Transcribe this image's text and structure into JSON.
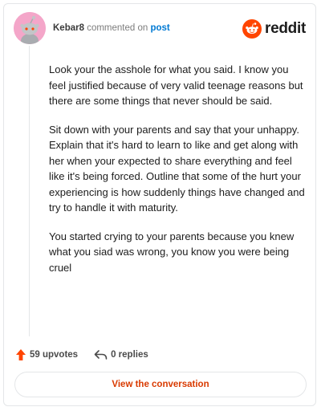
{
  "comment": {
    "author": "Kebar8",
    "action_text": "commented on",
    "post_link": "post",
    "brand_text": "reddit",
    "paragraphs": [
      "Look your the asshole for what you said. I know you feel justified because of very valid teenage reasons but there are some things that never should be said.",
      "Sit down with your parents and say that your unhappy. Explain that it's hard to learn to like and get along with her when your expected to share everything and feel like it's being forced. Outline that some of the hurt your experiencing is how suddenly things have changed and try to handle it with maturity.",
      "You started crying to your parents because you knew what you siad was wrong, you know you were being cruel"
    ],
    "upvotes_label": "59 upvotes",
    "replies_label": "0 replies",
    "cta_label": "View the conversation"
  },
  "icons": {
    "avatar": "snoo-avatar",
    "brand": "reddit-snoo-logo",
    "upvote": "upvote-arrow-icon",
    "reply": "reply-arrow-icon"
  },
  "colors": {
    "brand_orange": "#ff4500",
    "avatar_pink": "#f4a6c9",
    "link_blue": "#0079d3",
    "cta_text": "#d93a00",
    "border": "#e4e6e8"
  }
}
